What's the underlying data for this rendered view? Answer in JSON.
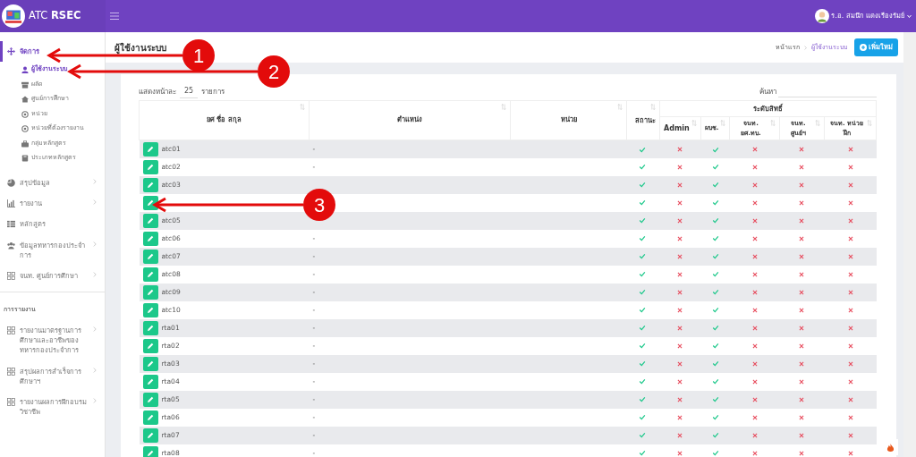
{
  "brand": {
    "prefix": "ATC",
    "name": "RSEC"
  },
  "user": {
    "name": "ร.อ. สมนึก แดงเรืองรัมย์"
  },
  "sidebar": {
    "items": [
      {
        "label": "จัดการ",
        "selected": true,
        "has_arrow": false,
        "children": [
          {
            "label": "ผู้ใช้งานระบบ",
            "selected": true
          },
          {
            "label": "ผลัด",
            "selected": false
          },
          {
            "label": "ศูนย์การศึกษา",
            "selected": false
          },
          {
            "label": "หน่วย",
            "selected": false
          },
          {
            "label": "หน่วยที่ต้องรายงาน",
            "selected": false
          },
          {
            "label": "กลุ่มหลักสูตร",
            "selected": false
          },
          {
            "label": "ประเภทหลักสูตร",
            "selected": false
          }
        ]
      },
      {
        "label": "สรุปข้อมูล",
        "selected": false,
        "has_arrow": true
      },
      {
        "label": "รายงาน",
        "selected": false,
        "has_arrow": true
      },
      {
        "label": "หลักสูตร",
        "selected": false,
        "has_arrow": false
      },
      {
        "label": "ข้อมูลทหารกองประจำการ",
        "selected": false,
        "has_arrow": true
      },
      {
        "label": "จนท. ศูนย์การศึกษา",
        "selected": false,
        "has_arrow": true
      }
    ],
    "section": "การรายงาน",
    "report_items": [
      {
        "label": "รายงานมาตรฐานการศึกษาและอาชีพของทหารกองประจำการ",
        "selected": false,
        "has_arrow": true
      },
      {
        "label": "สรุปผลการสำเร็จการศึกษาฯ",
        "selected": false,
        "has_arrow": true
      },
      {
        "label": "รายงานผลการฝึกอบรมวิชาชีพ",
        "selected": false,
        "has_arrow": true
      }
    ]
  },
  "page": {
    "title": "ผู้ใช้งานระบบ",
    "breadcrumb": [
      "หน้าแรก",
      "ผู้ใช้งานระบบ"
    ],
    "add_button": "เพิ่มใหม่"
  },
  "table": {
    "length_label": "แสดงหน้าละ",
    "length_value": "25",
    "length_suffix": "รายการ",
    "search_label": "ค้นหา",
    "group_header": "ระดับสิทธิ์",
    "columns": [
      "ยศ ชื่อ สกุล",
      "ตำแหน่ง",
      "หน่วย",
      "สถานะ",
      "Admin",
      "ผบช.",
      "จนท. ยศ.ทบ.",
      "จนท. ศูนย์ฯ",
      "จนท. หน่วยฝึก"
    ],
    "rows": [
      {
        "name": "atc01",
        "position": "-",
        "flags": [
          true,
          false,
          true,
          false,
          false,
          false
        ]
      },
      {
        "name": "atc02",
        "position": "-",
        "flags": [
          true,
          false,
          true,
          false,
          false,
          false
        ]
      },
      {
        "name": "atc03",
        "flags": [
          true,
          false,
          true,
          false,
          false,
          false
        ]
      },
      {
        "flags": [
          true,
          false,
          true,
          false,
          false,
          false
        ]
      },
      {
        "name": "atc05",
        "flags": [
          true,
          false,
          true,
          false,
          false,
          false
        ]
      },
      {
        "name": "atc06",
        "position": "-",
        "flags": [
          true,
          false,
          true,
          false,
          false,
          false
        ]
      },
      {
        "name": "atc07",
        "position": "-",
        "flags": [
          true,
          false,
          true,
          false,
          false,
          false
        ]
      },
      {
        "name": "atc08",
        "position": "-",
        "flags": [
          true,
          false,
          true,
          false,
          false,
          false
        ]
      },
      {
        "name": "atc09",
        "position": "-",
        "flags": [
          true,
          false,
          true,
          false,
          false,
          false
        ]
      },
      {
        "name": "atc10",
        "position": "-",
        "flags": [
          true,
          false,
          true,
          false,
          false,
          false
        ]
      },
      {
        "name": "rta01",
        "position": "-",
        "flags": [
          true,
          false,
          true,
          false,
          false,
          false
        ]
      },
      {
        "name": "rta02",
        "position": "-",
        "flags": [
          true,
          false,
          true,
          false,
          false,
          false
        ]
      },
      {
        "name": "rta03",
        "position": "-",
        "flags": [
          true,
          false,
          true,
          false,
          false,
          false
        ]
      },
      {
        "name": "rta04",
        "position": "-",
        "flags": [
          true,
          false,
          true,
          false,
          false,
          false
        ]
      },
      {
        "name": "rta05",
        "position": "-",
        "flags": [
          true,
          false,
          true,
          false,
          false,
          false
        ]
      },
      {
        "name": "rta06",
        "position": "-",
        "flags": [
          true,
          false,
          true,
          false,
          false,
          false
        ]
      },
      {
        "name": "rta07",
        "position": "-",
        "flags": [
          true,
          false,
          true,
          false,
          false,
          false
        ]
      },
      {
        "name": "rta08",
        "position": "-",
        "flags": [
          true,
          false,
          true,
          false,
          false,
          false
        ]
      }
    ]
  },
  "annotations": [
    {
      "number": "1"
    },
    {
      "number": "2"
    },
    {
      "number": "3"
    }
  ]
}
